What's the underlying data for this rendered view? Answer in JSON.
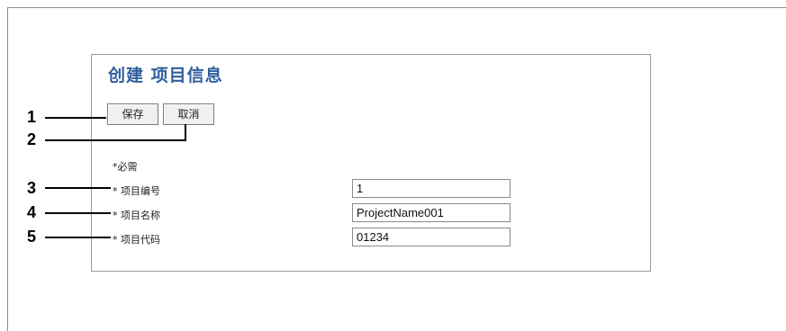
{
  "dialog": {
    "title": "创建 项目信息",
    "buttons": {
      "save": "保存",
      "cancel": "取消"
    },
    "required_note": "*必需",
    "fields": [
      {
        "label": "* 项目编号",
        "value": "1"
      },
      {
        "label": "* 项目名称",
        "value": "ProjectName001"
      },
      {
        "label": "* 项目代码",
        "value": "01234"
      }
    ]
  },
  "callouts": [
    "1",
    "2",
    "3",
    "4",
    "5"
  ]
}
